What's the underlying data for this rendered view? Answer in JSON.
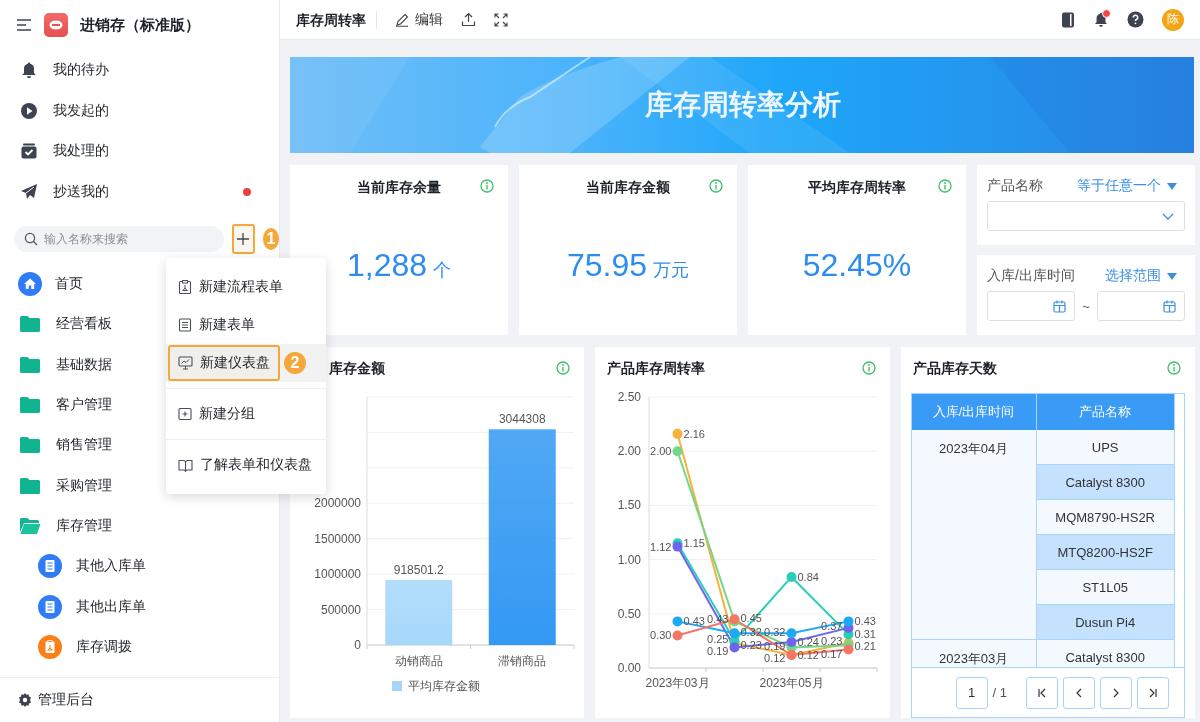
{
  "app": {
    "title": "进销存（标准版）"
  },
  "sidebar": {
    "quick_links": [
      {
        "label": "我的待办",
        "unread": false
      },
      {
        "label": "我发起的",
        "unread": false
      },
      {
        "label": "我处理的",
        "unread": false
      },
      {
        "label": "抄送我的",
        "unread": true
      }
    ],
    "search": {
      "placeholder": "输入名称来搜索"
    },
    "add_step": "1",
    "nav": [
      {
        "label": "首页",
        "kind": "home"
      },
      {
        "label": "经营看板",
        "kind": "folder",
        "expanded": false
      },
      {
        "label": "基础数据",
        "kind": "folder",
        "expanded": false
      },
      {
        "label": "客户管理",
        "kind": "folder",
        "expanded": false
      },
      {
        "label": "销售管理",
        "kind": "folder",
        "expanded": false
      },
      {
        "label": "采购管理",
        "kind": "folder",
        "expanded": false
      },
      {
        "label": "库存管理",
        "kind": "folder",
        "expanded": true,
        "children": [
          {
            "label": "其他入库单",
            "kind": "form"
          },
          {
            "label": "其他出库单",
            "kind": "form"
          },
          {
            "label": "库存调拨",
            "kind": "transfer"
          }
        ]
      }
    ],
    "footer": "管理后台"
  },
  "menu": {
    "groups": [
      [
        {
          "label": "新建流程表单",
          "selected": false
        },
        {
          "label": "新建表单",
          "selected": false
        },
        {
          "label": "新建仪表盘",
          "selected": true,
          "step": "2"
        }
      ],
      [
        {
          "label": "新建分组",
          "selected": false
        }
      ],
      [
        {
          "label": "了解表单和仪表盘",
          "selected": false
        }
      ]
    ]
  },
  "header": {
    "title": "库存周转率",
    "edit": "编辑",
    "has_notification": true,
    "avatar": "陈"
  },
  "banner": {
    "title": "库存周转率分析"
  },
  "kpis": [
    {
      "title": "当前库存余量",
      "value": "1,288",
      "unit": "个"
    },
    {
      "title": "当前库存金额",
      "value": "75.95",
      "unit": "万元"
    },
    {
      "title": "平均库存周转率",
      "value": "52.45%"
    }
  ],
  "filters": [
    {
      "kind": "select",
      "label": "产品名称",
      "operator": "等于任意一个"
    },
    {
      "kind": "date-range",
      "label": "入库/出库时间",
      "operator": "选择范围",
      "separator": "~"
    }
  ],
  "charts": [
    {
      "title": "库存金额",
      "chart_data": {
        "type": "bar",
        "categories": [
          "动销商品",
          "滞销商品"
        ],
        "ylim": [
          0,
          3500000
        ],
        "grid": true,
        "yticks": [
          0,
          500000,
          1000000,
          1500000,
          2000000
        ],
        "data_labels": true,
        "series": [
          {
            "name": "平均库存金额",
            "color": "#a6d3f8",
            "values": [
              918501.2,
              3044308
            ]
          }
        ]
      }
    },
    {
      "title": "产品库存周转率",
      "chart_data": {
        "type": "line",
        "categories": [
          "2023年03月",
          null,
          "2023年05月",
          null
        ],
        "ylim": [
          0,
          2.5
        ],
        "grid": true,
        "yticks": [
          {
            "value": 0,
            "label": "0.00"
          },
          {
            "value": 0.5,
            "label": "0.50"
          },
          {
            "value": 1,
            "label": "1.00"
          },
          {
            "value": 1.5,
            "label": "1.50"
          },
          {
            "value": 2,
            "label": "2.00"
          },
          {
            "value": 2.5,
            "label": "2.50"
          }
        ],
        "series": [
          {
            "color": "#f8b13a",
            "marker": "circle",
            "values": [
              2.16,
              0.23,
              0.12,
              0.23
            ],
            "value_labels": [
              "2.16",
              "0.23",
              "0.12",
              "0.23"
            ]
          },
          {
            "color": "#74d68a",
            "marker": "circle",
            "values": [
              2.0,
              0.43,
              0.19,
              0.21
            ],
            "value_labels": [
              "2.00",
              "0.43",
              "0.19",
              "0.21"
            ]
          },
          {
            "color": "#26cfb5",
            "marker": "circle",
            "values": [
              1.15,
              0.25,
              0.84,
              0.31
            ],
            "value_labels": [
              "1.15",
              "0.25",
              "0.84",
              "0.31"
            ]
          },
          {
            "color": "#6f64ef",
            "marker": "circle",
            "values": [
              1.12,
              0.19,
              0.24,
              0.37
            ],
            "value_labels": [
              "1.12",
              "0.19",
              "0.24",
              "0.37"
            ]
          },
          {
            "color": "#1fa8f5",
            "marker": "circle",
            "values": [
              0.43,
              0.32,
              0.32,
              0.43
            ],
            "value_labels": [
              "0.43",
              "0.32",
              "0.32",
              "0.43"
            ]
          },
          {
            "color": "#f57567",
            "marker": "circle",
            "values": [
              0.3,
              0.45,
              0.12,
              0.17
            ],
            "value_labels": [
              "0.30",
              "0.45",
              "0.12",
              "0.17"
            ]
          }
        ]
      }
    }
  ],
  "table_card": {
    "title": "产品库存天数",
    "columns": [
      "入库/出库时间",
      "产品名称"
    ],
    "groups": [
      {
        "period": "2023年04月",
        "products": [
          "UPS",
          "Catalyst 8300",
          "MQM8790-HS2R",
          "MTQ8200-HS2F",
          "ST1L05",
          "Dusun Pi4"
        ]
      },
      {
        "period": "2023年03月",
        "products": [
          "Catalyst 8300"
        ]
      }
    ],
    "pagination": {
      "page": "1",
      "total": "/ 1"
    }
  }
}
